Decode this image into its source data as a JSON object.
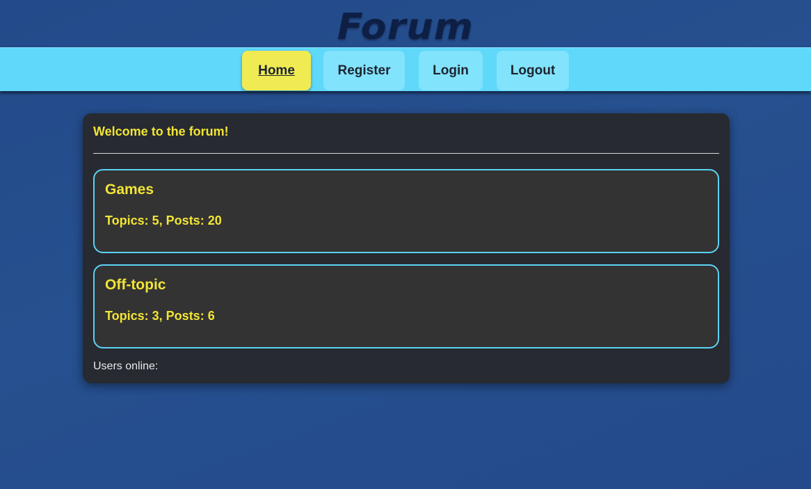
{
  "site": {
    "logo": "Forum"
  },
  "nav": {
    "home": "Home",
    "register": "Register",
    "login": "Login",
    "logout": "Logout"
  },
  "main": {
    "welcome": "Welcome to the forum!",
    "categories": [
      {
        "title": "Games",
        "stats": "Topics: 5, Posts: 20"
      },
      {
        "title": "Off-topic",
        "stats": "Topics: 3, Posts: 6"
      }
    ],
    "users_online": "Users online:"
  },
  "colors": {
    "background": "#244a8c",
    "navbar": "#5fd8fa",
    "nav_button": "#82e3fd",
    "nav_active": "#f0eb52",
    "panel": "#272a31",
    "card": "#333333",
    "card_border": "#5cd3f5",
    "accent_text": "#f2e535"
  }
}
